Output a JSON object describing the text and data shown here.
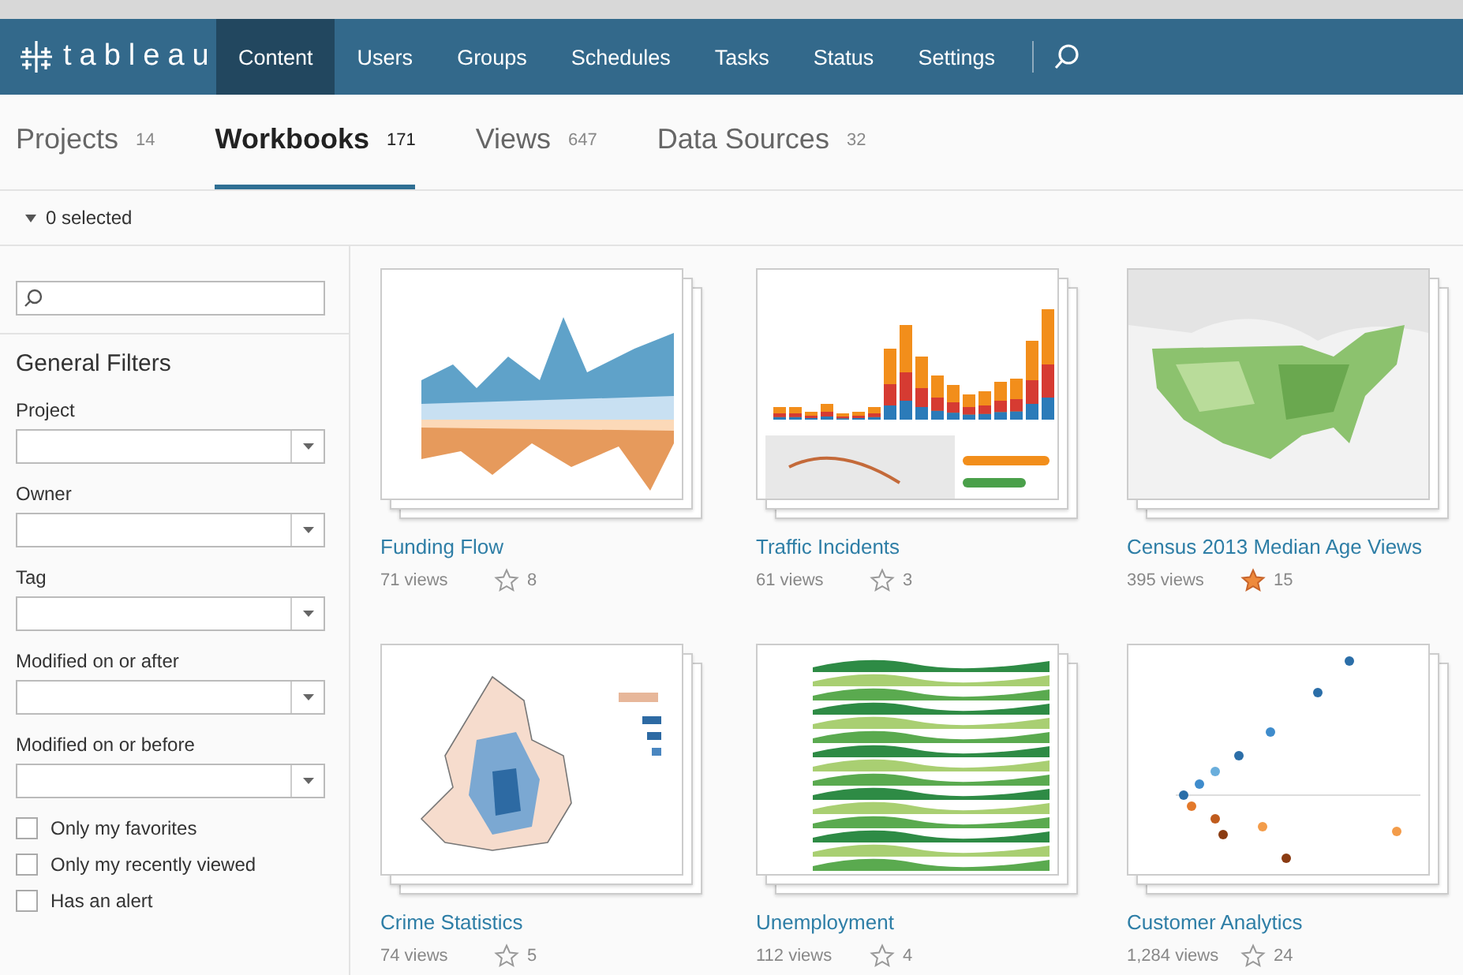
{
  "nav": {
    "logo": "tableau",
    "items": [
      {
        "label": "Content",
        "selected": true
      },
      {
        "label": "Users",
        "selected": false
      },
      {
        "label": "Groups",
        "selected": false
      },
      {
        "label": "Schedules",
        "selected": false
      },
      {
        "label": "Tasks",
        "selected": false
      },
      {
        "label": "Status",
        "selected": false
      },
      {
        "label": "Settings",
        "selected": false
      }
    ]
  },
  "tabs": [
    {
      "label": "Projects",
      "count": "14",
      "selected": false
    },
    {
      "label": "Workbooks",
      "count": "171",
      "selected": true
    },
    {
      "label": "Views",
      "count": "647",
      "selected": false
    },
    {
      "label": "Data Sources",
      "count": "32",
      "selected": false
    }
  ],
  "selection": "0 selected",
  "sidebar": {
    "heading": "General Filters",
    "filters": [
      {
        "label": "Project"
      },
      {
        "label": "Owner"
      },
      {
        "label": "Tag"
      },
      {
        "label": "Modified on or after"
      },
      {
        "label": "Modified on or before"
      }
    ],
    "checkboxes": [
      {
        "label": "Only my favorites",
        "checked": false
      },
      {
        "label": "Only my recently viewed",
        "checked": false
      },
      {
        "label": "Has an alert",
        "checked": false
      }
    ]
  },
  "workbooks": [
    {
      "title": "Funding Flow",
      "views": "71 views",
      "favorites": "8",
      "favorited": false
    },
    {
      "title": "Traffic Incidents",
      "views": "61 views",
      "favorites": "3",
      "favorited": false
    },
    {
      "title": "Census 2013 Median Age Views",
      "views": "395 views",
      "favorites": "15",
      "favorited": true
    },
    {
      "title": "Crime Statistics",
      "views": "74 views",
      "favorites": "5",
      "favorited": false
    },
    {
      "title": "Unemployment",
      "views": "112 views",
      "favorites": "4",
      "favorited": false
    },
    {
      "title": "Customer Analytics",
      "views": "1,284 views",
      "favorites": "24",
      "favorited": false
    }
  ]
}
